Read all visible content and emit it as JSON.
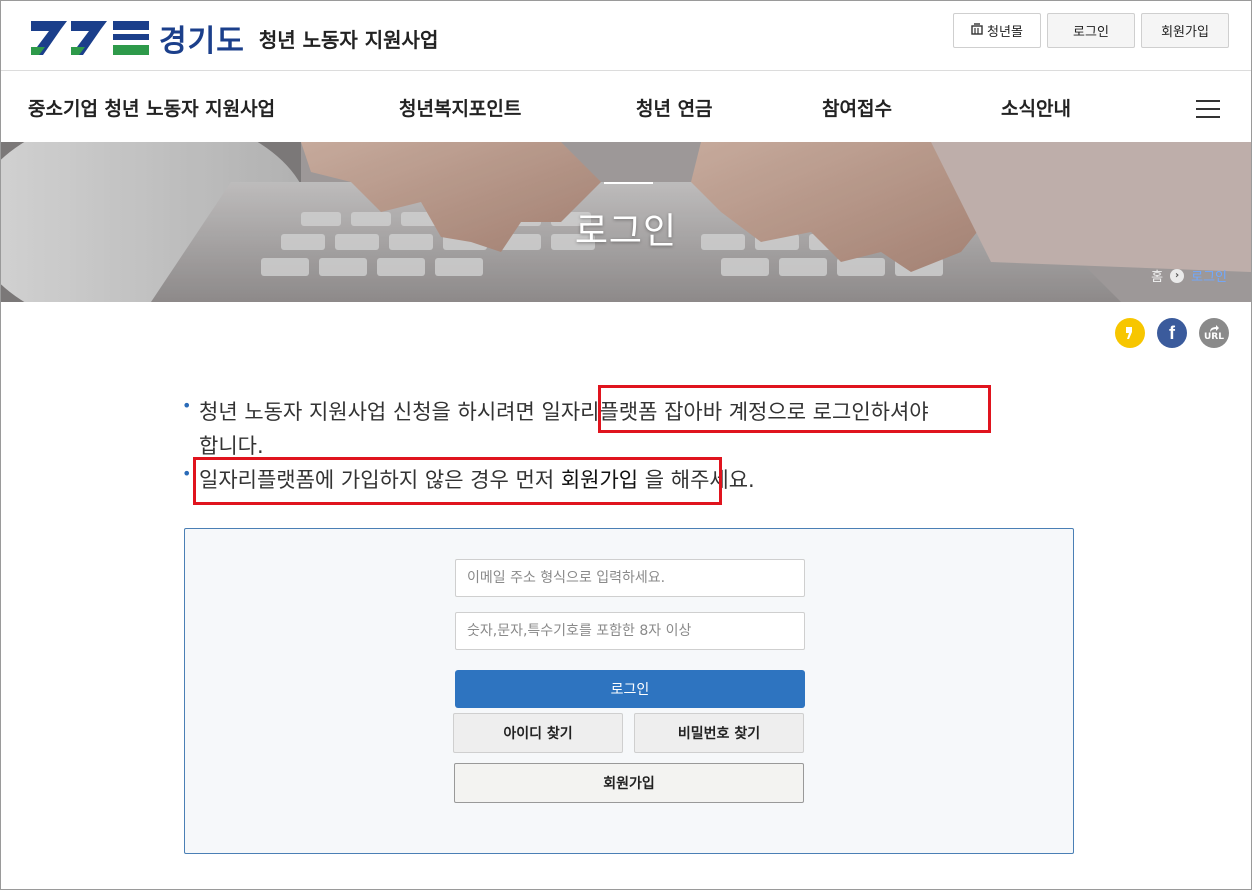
{
  "header": {
    "logo_text": "경기도",
    "logo_sub": "청년 노동자 지원사업",
    "shop_label": "청년몰",
    "login_label": "로그인",
    "join_label": "회원가입"
  },
  "nav": {
    "items": [
      {
        "label": "중소기업 청년 노동자 지원사업"
      },
      {
        "label": "청년복지포인트"
      },
      {
        "label": "청년 연금"
      },
      {
        "label": "참여접수"
      },
      {
        "label": "소식안내"
      }
    ]
  },
  "hero": {
    "title": "로그인",
    "breadcrumb_home": "홈",
    "breadcrumb_sep": "›",
    "breadcrumb_current": "로그인"
  },
  "share": {
    "kakao": "kakao-story-icon",
    "facebook": "f",
    "url_label": "URL"
  },
  "notice": {
    "line1_a": "청년 노동자 지원사업 신청을 하시려면 ",
    "line1_b": "일자리플랫폼 잡아바 계정으로 로그인",
    "line1_c": "하셔야",
    "line1_d": "합니다.",
    "line2_a": "일자리플랫폼에 가입하지 않은 경우 먼저 ",
    "line2_b": "회원가입",
    "line2_c": " 을 해주세요."
  },
  "login": {
    "email_placeholder": "이메일 주소 형식으로 입력하세요.",
    "email_value": "",
    "password_placeholder": "숫자,문자,특수기호를 포함한 8자 이상",
    "password_value": "",
    "login_button": "로그인",
    "find_id_button": "아이디 찾기",
    "find_pw_button": "비밀번호 찾기",
    "join_button": "회원가입"
  },
  "colors": {
    "brand_blue": "#1b3f8b",
    "brand_green": "#2e9a4a",
    "login_blue": "#2e74c0",
    "highlight_red": "#e0141e"
  }
}
